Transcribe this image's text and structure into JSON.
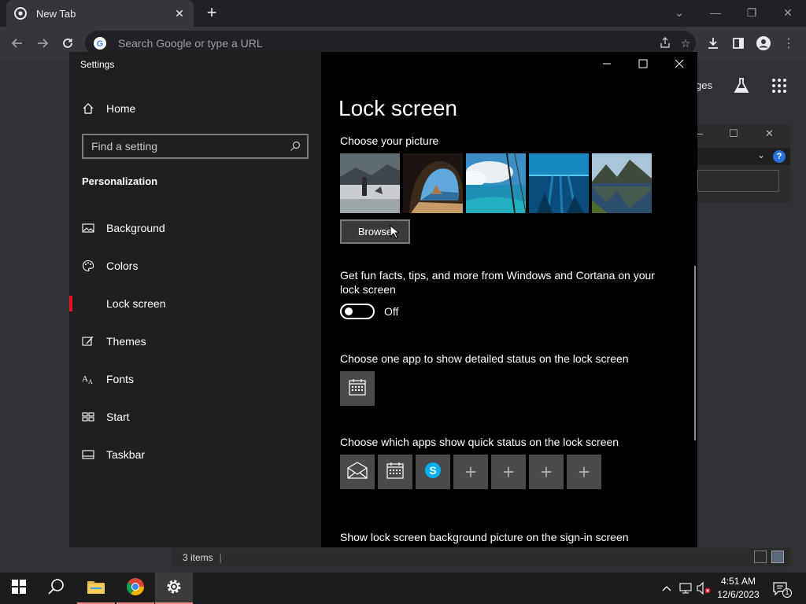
{
  "chrome": {
    "tab_title": "New Tab",
    "omnibox_placeholder": "Search Google or type a URL",
    "images_link": "ges"
  },
  "settings": {
    "window_title": "Settings",
    "home_label": "Home",
    "search_placeholder": "Find a setting",
    "section_heading": "Personalization",
    "nav_items": [
      {
        "label": "Background",
        "icon": "image-icon"
      },
      {
        "label": "Colors",
        "icon": "palette-icon"
      },
      {
        "label": "Lock screen",
        "icon": "lock-screen-icon"
      },
      {
        "label": "Themes",
        "icon": "themes-icon"
      },
      {
        "label": "Fonts",
        "icon": "fonts-icon"
      },
      {
        "label": "Start",
        "icon": "start-icon"
      },
      {
        "label": "Taskbar",
        "icon": "taskbar-icon"
      }
    ],
    "active_nav": "Lock screen",
    "page_title": "Lock screen",
    "choose_picture_label": "Choose your picture",
    "browse_label": "Browse",
    "fun_facts_label": "Get fun facts, tips, and more from Windows and Cortana on your lock screen",
    "toggle_state": "Off",
    "detailed_status_label": "Choose one app to show detailed status on the lock screen",
    "quick_status_label": "Choose which apps show quick status on the lock screen",
    "sign_in_label": "Show lock screen background picture on the sign-in screen",
    "quick_status_apps": [
      "mail-icon",
      "calendar-icon",
      "skype-icon",
      "add-icon",
      "add-icon",
      "add-icon",
      "add-icon"
    ]
  },
  "explorer": {
    "status_text": "3 items"
  },
  "taskbar": {
    "time": "4:51 AM",
    "date": "12/6/2023",
    "notification_count": "1"
  },
  "colors": {
    "accent_red": "#e81123",
    "settings_nav_bg": "#1f1f1f",
    "settings_main_bg": "#000000"
  }
}
